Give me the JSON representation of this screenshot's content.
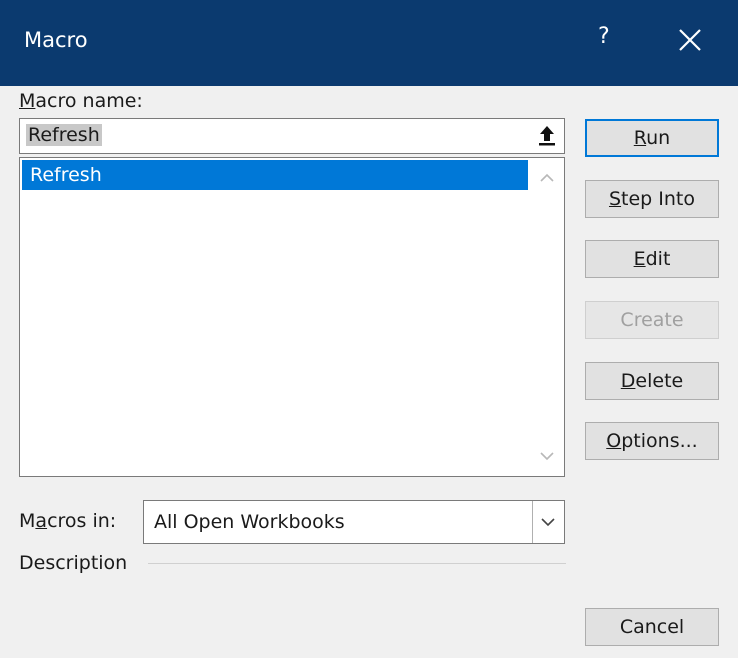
{
  "window": {
    "title": "Macro",
    "help": "?"
  },
  "macro_name": {
    "label_key": "M",
    "label_rest": "acro name:",
    "value": "Refresh"
  },
  "macro_list": {
    "items": [
      "Refresh"
    ],
    "selected": "Refresh"
  },
  "macros_in": {
    "label_pre": "M",
    "label_key": "a",
    "label_rest": "cros in:",
    "value": "All Open Workbooks"
  },
  "description": {
    "label": "Description"
  },
  "buttons": {
    "run": {
      "key": "R",
      "rest": "un"
    },
    "step_into": {
      "key": "S",
      "rest": "tep Into"
    },
    "edit": {
      "key": "E",
      "rest": "dit"
    },
    "create": {
      "label": "Create"
    },
    "delete": {
      "key": "D",
      "rest": "elete"
    },
    "options": {
      "key": "O",
      "rest": "ptions..."
    },
    "cancel": {
      "label": "Cancel"
    }
  },
  "icons": {
    "close": "close-icon",
    "upload": "upload-arrow-icon",
    "scroll_up": "chevron-up-icon",
    "scroll_down": "chevron-down-icon",
    "dropdown": "chevron-down-icon"
  },
  "colors": {
    "titlebar": "#0b3a6f",
    "selection": "#0078d7",
    "default_border": "#0078d7"
  }
}
